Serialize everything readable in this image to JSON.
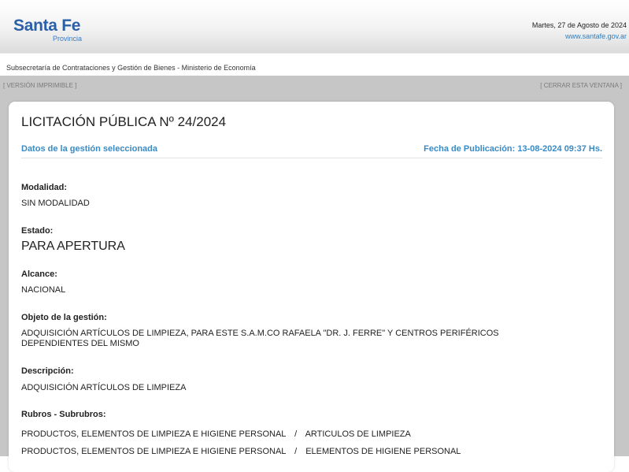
{
  "header": {
    "logo_main": "Santa Fe",
    "logo_sub": "Provincia",
    "date": "Martes, 27 de Agosto de 2024",
    "site": "www.santafe.gov.ar"
  },
  "subheader": {
    "text": "Subsecretaría de Contrataciones y Gestión de Bienes - Ministerio de Economía"
  },
  "toolbar": {
    "print_label": "[ VERSIÓN IMPRIMIBLE ]",
    "close_label": "[ CERRAR ESTA VENTANA ]"
  },
  "main": {
    "title": "LICITACIÓN PÚBLICA Nº 24/2024",
    "section_label": "Datos de la gestión seleccionada",
    "published": "Fecha de Publicación: 13-08-2024 09:37 Hs.",
    "fields": {
      "modalidad_label": "Modalidad:",
      "modalidad_value": "SIN MODALIDAD",
      "estado_label": "Estado:",
      "estado_value": "PARA APERTURA",
      "alcance_label": "Alcance:",
      "alcance_value": "NACIONAL",
      "objeto_label": "Objeto de la gestión:",
      "objeto_line1": "ADQUISICIÓN ARTÍCULOS DE LIMPIEZA, PARA ESTE S.A.M.CO RAFAELA \"DR. J. FERRE\" Y CENTROS PERIFÉRICOS",
      "objeto_line2": "DEPENDIENTES DEL MISMO",
      "descripcion_label": "Descripción:",
      "descripcion_value": "ADQUISICIÓN ARTÍCULOS DE LIMPIEZA",
      "rubros_label": "Rubros - Subrubros:"
    },
    "rubros": [
      {
        "rubro": "PRODUCTOS, ELEMENTOS DE LIMPIEZA E HIGIENE PERSONAL",
        "separator": "/",
        "subrubro": "ARTICULOS DE LIMPIEZA"
      },
      {
        "rubro": "PRODUCTOS, ELEMENTOS DE LIMPIEZA E HIGIENE PERSONAL",
        "separator": "/",
        "subrubro": "ELEMENTOS DE HIGIENE PERSONAL"
      }
    ]
  }
}
